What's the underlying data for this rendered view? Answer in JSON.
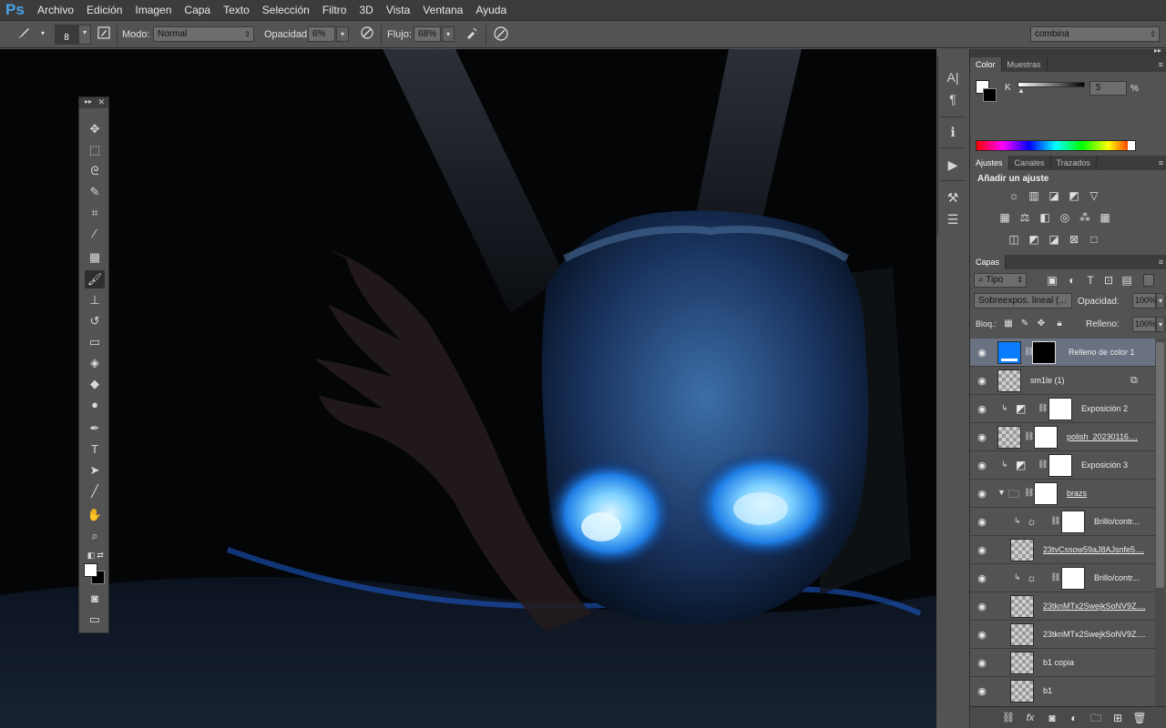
{
  "app": {
    "logo": "Ps"
  },
  "menu": [
    "Archivo",
    "Edición",
    "Imagen",
    "Capa",
    "Texto",
    "Selección",
    "Filtro",
    "3D",
    "Vista",
    "Ventana",
    "Ayuda"
  ],
  "options": {
    "brush_size": "8",
    "mode_label": "Modo:",
    "mode_value": "Normal",
    "opacity_label": "Opacidad:",
    "opacity_value": "6%",
    "flow_label": "Flujo:",
    "flow_value": "68%",
    "workspace": "combina"
  },
  "color_panel": {
    "tabs": [
      "Color",
      "Muestras"
    ],
    "channel": "K",
    "value": "5",
    "unit": "%"
  },
  "adjust_panel": {
    "tabs": [
      "Ajustes",
      "Canales",
      "Trazados"
    ],
    "heading": "Añadir un ajuste"
  },
  "layers_panel": {
    "tab": "Capas",
    "filter": "Tipo",
    "blend_mode": "Sobreexpos. lineal (...",
    "opacity_label": "Opacidad:",
    "opacity_value": "100%",
    "lock_label": "Bloq.:",
    "fill_label": "Relleno:",
    "fill_value": "100%",
    "layers": [
      {
        "name": "Relleno de color 1"
      },
      {
        "name": "sm1le (1)"
      },
      {
        "name": "Exposición 2"
      },
      {
        "name": "polish_20230116...."
      },
      {
        "name": "Exposición 3"
      },
      {
        "name": "brazs"
      },
      {
        "name": "Brillo/contr..."
      },
      {
        "name": "23tvCssow59aJ8AJsnfe5...."
      },
      {
        "name": "Brillo/contr..."
      },
      {
        "name": "23tknMTx2SwejkSoNV9Z...."
      },
      {
        "name": "23tknMTx2SwejkSoNV9Z...."
      },
      {
        "name": "b1 copia"
      },
      {
        "name": "b1"
      }
    ]
  },
  "colors": {
    "accent": "#0a7cff",
    "selected_row": "#6a7180",
    "panel_bg": "#535353",
    "menubar_bg": "#3c3c3c"
  }
}
